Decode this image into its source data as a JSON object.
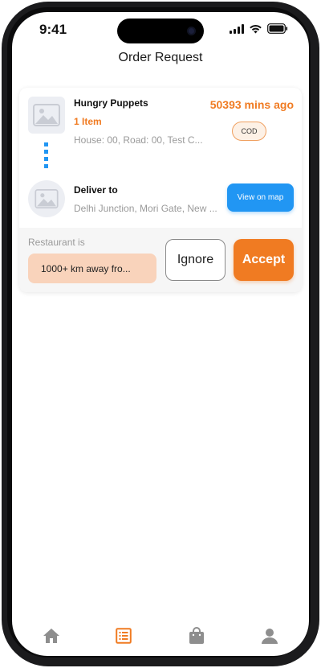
{
  "status_bar": {
    "time": "9:41"
  },
  "header": {
    "title": "Order Request"
  },
  "order": {
    "restaurant_name": "Hungry Puppets",
    "item_count": "1 Item",
    "restaurant_address": "House: 00, Road: 00, Test C...",
    "time_ago": "50393 mins ago",
    "payment_badge": "COD",
    "deliver_label": "Deliver to",
    "delivery_address": "Delhi Junction, Mori Gate, New ...",
    "map_button_label": "View on map",
    "restaurant_is_label": "Restaurant is",
    "distance_text": "1000+ km away fro...",
    "ignore_label": "Ignore",
    "accept_label": "Accept"
  },
  "bottom_nav": {
    "items": [
      {
        "icon": "home-icon",
        "active": false
      },
      {
        "icon": "order-list-icon",
        "active": true
      },
      {
        "icon": "shopping-bag-icon",
        "active": false
      },
      {
        "icon": "person-icon",
        "active": false
      }
    ]
  },
  "colors": {
    "accent_orange": "#f07b22",
    "accent_blue": "#2196f3",
    "distance_pill_bg": "#f9d3bb",
    "inactive_icon": "#8e8e8e"
  }
}
